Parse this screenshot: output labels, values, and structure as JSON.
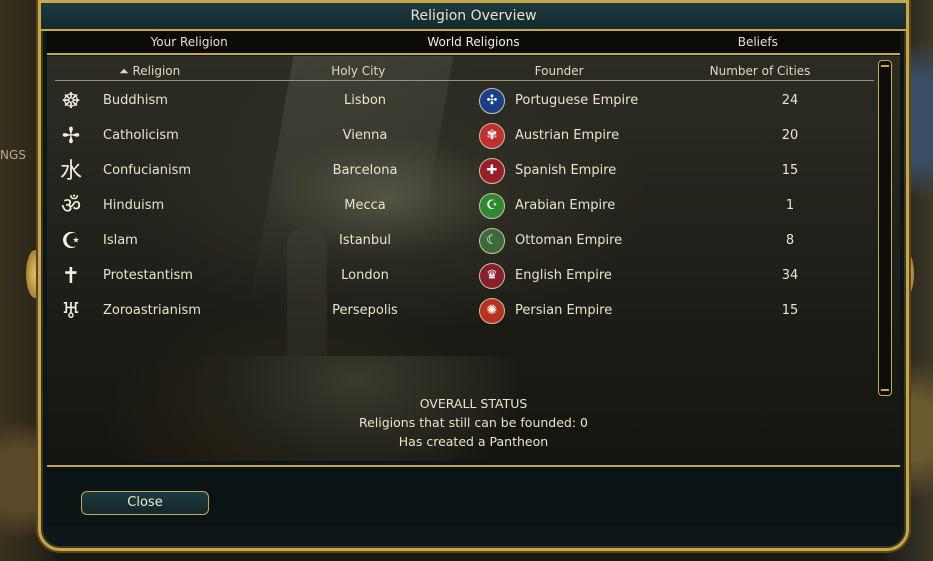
{
  "window": {
    "title": "Religion Overview"
  },
  "tabs": [
    {
      "label": "Your Religion"
    },
    {
      "label": "World Religions"
    },
    {
      "label": "Beliefs"
    }
  ],
  "columns": {
    "religion": "Religion",
    "holy_city": "Holy City",
    "founder": "Founder",
    "num_cities": "Number of Cities"
  },
  "religions": [
    {
      "name": "Buddhism",
      "icon": "dharma-wheel-icon",
      "glyph": "☸",
      "holy_city": "Lisbon",
      "founder": "Portuguese Empire",
      "civ_icon": "portugal-icon",
      "civ_color": "#1a3f8a",
      "civ_glyph": "✣",
      "cities": "24"
    },
    {
      "name": "Catholicism",
      "icon": "catholic-cross-icon",
      "glyph": "✢",
      "holy_city": "Vienna",
      "founder": "Austrian Empire",
      "civ_icon": "austria-icon",
      "civ_color": "#c22f2f",
      "civ_glyph": "✾",
      "cities": "20"
    },
    {
      "name": "Confucianism",
      "icon": "confucian-symbol-icon",
      "glyph": "水",
      "holy_city": "Barcelona",
      "founder": "Spanish Empire",
      "civ_icon": "spain-icon",
      "civ_color": "#9a1e2a",
      "civ_glyph": "✚",
      "cities": "15"
    },
    {
      "name": "Hinduism",
      "icon": "om-icon",
      "glyph": "ॐ",
      "holy_city": "Mecca",
      "founder": "Arabian Empire",
      "civ_icon": "arabia-icon",
      "civ_color": "#2e8a2e",
      "civ_glyph": "☪",
      "cities": "1"
    },
    {
      "name": "Islam",
      "icon": "crescent-icon",
      "glyph": "☪",
      "holy_city": "Istanbul",
      "founder": "Ottoman Empire",
      "civ_icon": "ottoman-icon",
      "civ_color": "#3b6b3b",
      "civ_glyph": "☾",
      "cities": "8"
    },
    {
      "name": "Protestantism",
      "icon": "latin-cross-icon",
      "glyph": "✝",
      "holy_city": "London",
      "founder": "English Empire",
      "civ_icon": "england-icon",
      "civ_color": "#8a1e2a",
      "civ_glyph": "♛",
      "cities": "34"
    },
    {
      "name": "Zoroastrianism",
      "icon": "faravahar-icon",
      "glyph": "♅",
      "holy_city": "Persepolis",
      "founder": "Persian Empire",
      "civ_icon": "persia-icon",
      "civ_color": "#b8321e",
      "civ_glyph": "✺",
      "cities": "15"
    }
  ],
  "status": {
    "heading": "OVERALL STATUS",
    "line1": "Religions that still can be founded: 0",
    "line2": "Has created a Pantheon"
  },
  "footer": {
    "close_label": "Close"
  },
  "map": {
    "fragment_text": "NGS"
  }
}
